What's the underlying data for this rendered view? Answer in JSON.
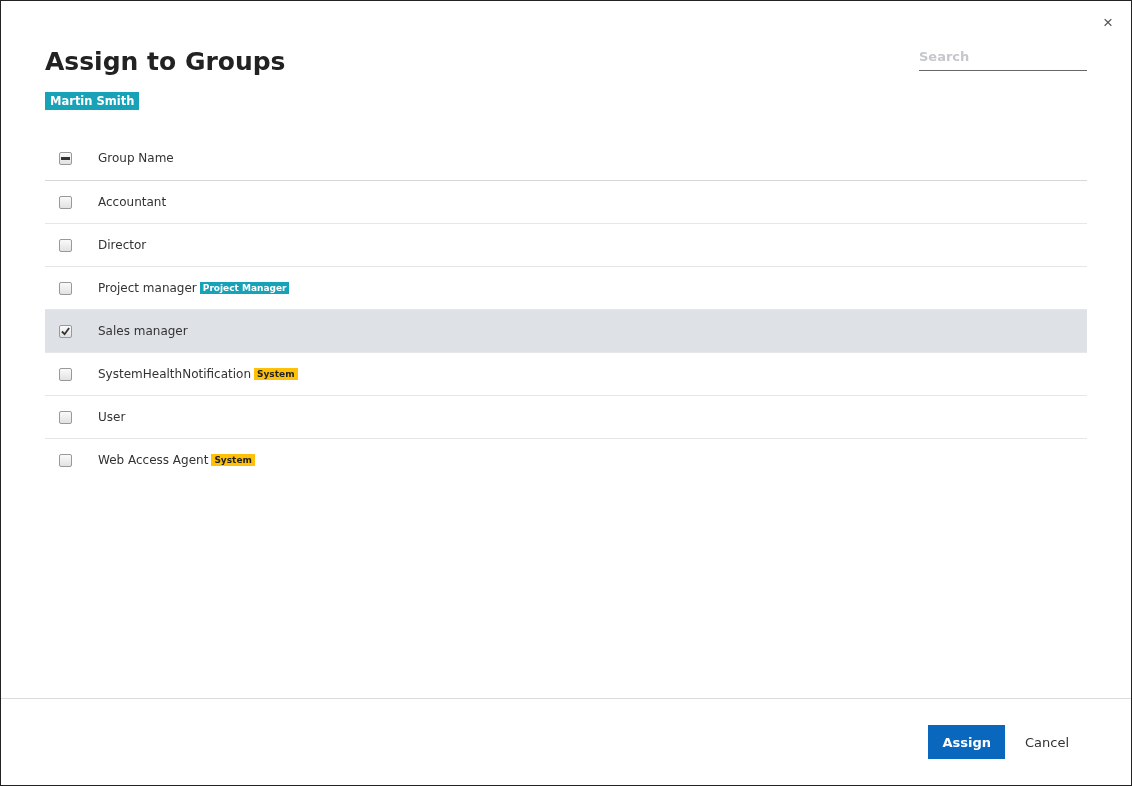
{
  "dialog": {
    "title": "Assign to Groups",
    "close": "×",
    "user_tag": "Martin Smith"
  },
  "search": {
    "placeholder": "Search"
  },
  "table": {
    "header": {
      "label": "Group Name",
      "indeterminate": true
    },
    "rows": [
      {
        "name": "Accountant",
        "checked": false,
        "selected": false
      },
      {
        "name": "Director",
        "checked": false,
        "selected": false
      },
      {
        "name": "Project manager",
        "checked": false,
        "selected": false,
        "tag": {
          "text": "Project Manager",
          "color": "#17a2b8"
        }
      },
      {
        "name": "Sales manager",
        "checked": true,
        "selected": true
      },
      {
        "name": "SystemHealthNotification",
        "checked": false,
        "selected": false,
        "tag": {
          "text": "System",
          "color": "#ffc107"
        }
      },
      {
        "name": "User",
        "checked": false,
        "selected": false
      },
      {
        "name": "Web Access Agent",
        "checked": false,
        "selected": false,
        "tag": {
          "text": "System",
          "color": "#ffc107"
        }
      }
    ]
  },
  "buttons": [
    {
      "label": "Assign",
      "kind": "primary"
    },
    {
      "label": "Cancel",
      "kind": "link"
    }
  ]
}
